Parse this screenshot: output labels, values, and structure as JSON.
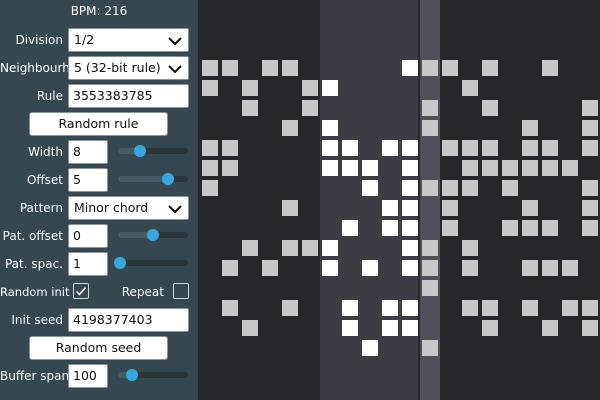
{
  "bpm_label": "BPM: 216",
  "controls": {
    "division": {
      "label": "Division",
      "value": "1/2"
    },
    "neighbourhood": {
      "label": "Neighbourh.",
      "value": "5 (32-bit rule)"
    },
    "rule": {
      "label": "Rule",
      "value": "3553383785"
    },
    "random_rule": {
      "label": "Random rule"
    },
    "width": {
      "label": "Width",
      "value": "8",
      "level": 0.32
    },
    "offset": {
      "label": "Offset",
      "value": "5",
      "level": 0.71
    },
    "pattern": {
      "label": "Pattern",
      "value": "Minor chord"
    },
    "pat_offset": {
      "label": "Pat. offset",
      "value": "0",
      "level": 0.5
    },
    "pat_spacing": {
      "label": "Pat. spac.",
      "value": "1",
      "level": 0.0
    },
    "random_init": {
      "label": "Random init",
      "checked": true
    },
    "repeat": {
      "label": "Repeat",
      "checked": false
    },
    "init_seed": {
      "label": "Init seed",
      "value": "4198377403"
    },
    "random_seed": {
      "label": "Random seed"
    },
    "buffer_span": {
      "label": "Buffer span",
      "value": "100",
      "level": 0.2
    }
  },
  "icons": {
    "dropdown": "chevron-down-icon",
    "checkbox": "checkmark-icon"
  },
  "colors": {
    "panel": "#37474f",
    "grid_background": "#27282c",
    "highlight_band": "#3c3c44",
    "playhead_band": "#50505a",
    "cell_off": "#c8c8c8",
    "cell_on": "#ffffff",
    "slider_thumb": "#35a8e0"
  },
  "grid": {
    "cols": 20,
    "rows": 18,
    "highlight_cols": [
      6,
      10
    ],
    "playhead_col": 11,
    "cells": [
      "0000000000000000000",
      "11011000001110100100",
      "10100110000001000000",
      "00100100000100100001",
      "00001010000100001001",
      "11000011011011101101",
      "11000011101001111110",
      "10000000101111010001",
      "00001000011010001001",
      "00000001011010011101",
      "00101110001101000000",
      "01010010101101001110",
      "00000000000100000000",
      "01001001011001101011",
      "00100001011000100101",
      "00000000100100000000",
      "00000000000000000000",
      "00000000000000000000"
    ]
  }
}
